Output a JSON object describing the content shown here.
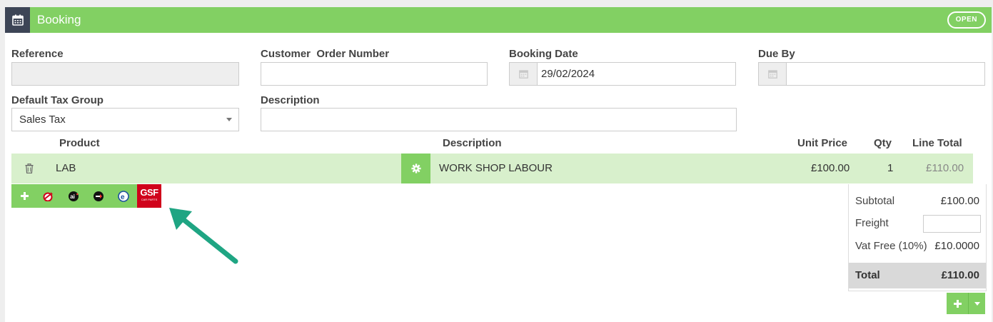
{
  "header": {
    "title": "Booking",
    "status": "OPEN"
  },
  "form": {
    "reference": {
      "label": "Reference",
      "value": ""
    },
    "customer_order": {
      "label": "Customer  Order Number",
      "value": ""
    },
    "booking_date": {
      "label": "Booking Date",
      "value": "29/02/2024"
    },
    "due_by": {
      "label": "Due By",
      "value": ""
    },
    "tax_group": {
      "label": "Default Tax Group",
      "value": "Sales Tax"
    },
    "description": {
      "label": "Description",
      "value": ""
    }
  },
  "lines": {
    "headers": {
      "product": "Product",
      "description": "Description",
      "unit_price": "Unit Price",
      "qty": "Qty",
      "line_total": "Line Total"
    },
    "rows": [
      {
        "product": "LAB",
        "description": "WORK SHOP LABOUR",
        "unit_price": "£100.00",
        "qty": "1",
        "line_total": "£110.00"
      }
    ]
  },
  "toolbar": {
    "items": [
      "add-icon",
      "parts-supplier-1-icon",
      "parts-supplier-ai-icon",
      "parts-supplier-3-icon",
      "parts-supplier-e-icon"
    ],
    "gsf_logo": "GSF",
    "gsf_sub": "CAR PARTS"
  },
  "totals": {
    "subtotal_label": "Subtotal",
    "subtotal_value": "£100.00",
    "freight_label": "Freight",
    "freight_value": "",
    "vat_label": "Vat Free (10%)",
    "vat_value": "£10.0000",
    "total_label": "Total",
    "total_value": "£110.00"
  },
  "colors": {
    "accent": "#82d063",
    "row_bg": "#d8f0cc",
    "header_icon_bg": "#3d4556",
    "arrow": "#1fa583"
  }
}
